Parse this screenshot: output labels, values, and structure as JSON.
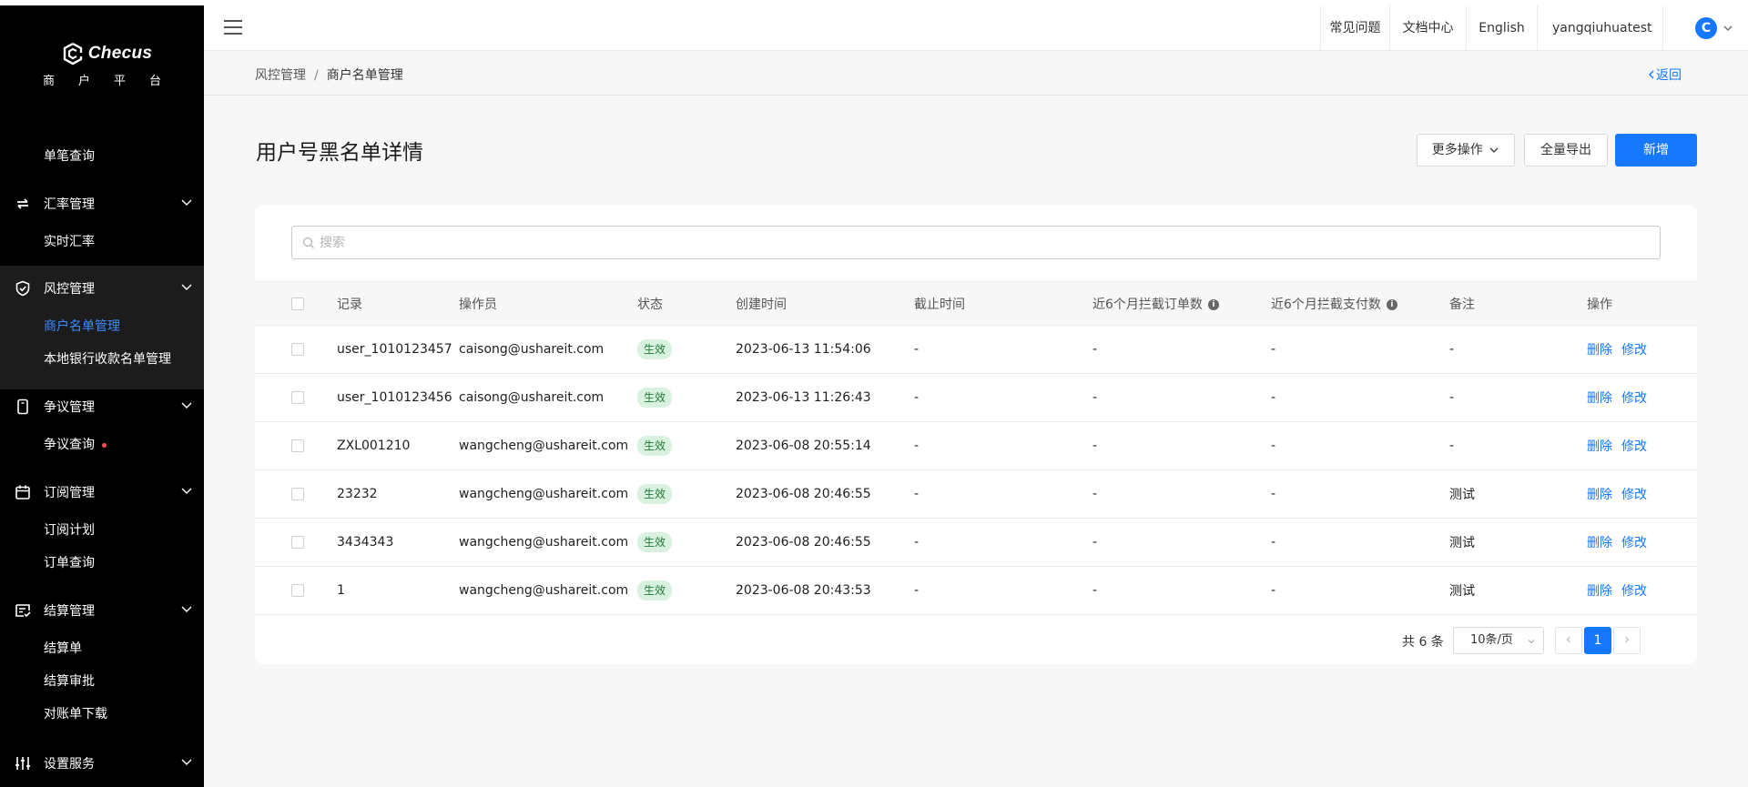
{
  "brand": {
    "name": "Checus",
    "subtitle": "商户平台"
  },
  "sidebar": {
    "single_query": "单笔查询",
    "groups": [
      {
        "label": "汇率管理",
        "icon": "exchange-icon",
        "items": [
          "实时汇率"
        ]
      },
      {
        "label": "风控管理",
        "icon": "shield-icon",
        "items": [
          "商户名单管理",
          "本地银行收款名单管理"
        ],
        "active_item": "商户名单管理"
      },
      {
        "label": "争议管理",
        "icon": "phone-icon",
        "items": [
          "争议查询"
        ]
      },
      {
        "label": "订阅管理",
        "icon": "calendar-icon",
        "items": [
          "订阅计划",
          "订单查询"
        ]
      },
      {
        "label": "结算管理",
        "icon": "invoice-icon",
        "items": [
          "结算单",
          "结算审批",
          "对账单下载"
        ]
      },
      {
        "label": "设置服务",
        "icon": "sliders-icon",
        "items": []
      }
    ]
  },
  "topbar": {
    "faq": "常见问题",
    "docs": "文档中心",
    "language": "English",
    "username": "yangqiuhuatest",
    "avatar_letter": "C"
  },
  "breadcrumb": {
    "parent": "风控管理",
    "separator": "/",
    "current": "商户名单管理",
    "back": "返回"
  },
  "page": {
    "title": "用户号黑名单详情",
    "more_actions": "更多操作",
    "export_all": "全量导出",
    "add_new": "新增"
  },
  "search": {
    "placeholder": "搜索"
  },
  "table": {
    "headers": [
      "记录",
      "操作员",
      "状态",
      "创建时间",
      "截止时间",
      "近6个月拦截订单数",
      "近6个月拦截支付数",
      "备注",
      "操作"
    ],
    "rows": [
      {
        "record": "user_1010123457",
        "operator": "caisong@ushareit.com",
        "status": "生效",
        "created": "2023-06-13 11:54:06",
        "deadline": "-",
        "orders": "-",
        "payments": "-",
        "remark": "-"
      },
      {
        "record": "user_1010123456",
        "operator": "caisong@ushareit.com",
        "status": "生效",
        "created": "2023-06-13 11:26:43",
        "deadline": "-",
        "orders": "-",
        "payments": "-",
        "remark": "-"
      },
      {
        "record": "ZXL001210",
        "operator": "wangcheng@ushareit.com",
        "status": "生效",
        "created": "2023-06-08 20:55:14",
        "deadline": "-",
        "orders": "-",
        "payments": "-",
        "remark": "-"
      },
      {
        "record": "23232",
        "operator": "wangcheng@ushareit.com",
        "status": "生效",
        "created": "2023-06-08 20:46:55",
        "deadline": "-",
        "orders": "-",
        "payments": "-",
        "remark": "测试"
      },
      {
        "record": "3434343",
        "operator": "wangcheng@ushareit.com",
        "status": "生效",
        "created": "2023-06-08 20:46:55",
        "deadline": "-",
        "orders": "-",
        "payments": "-",
        "remark": "测试"
      },
      {
        "record": "1",
        "operator": "wangcheng@ushareit.com",
        "status": "生效",
        "created": "2023-06-08 20:43:53",
        "deadline": "-",
        "orders": "-",
        "payments": "-",
        "remark": "测试"
      }
    ],
    "action_delete": "删除",
    "action_edit": "修改"
  },
  "pagination": {
    "total": "共 6 条",
    "page_size": "10条/页",
    "current_page": "1"
  },
  "colors": {
    "primary": "#1677ff",
    "sidebar_bg": "#000000",
    "status_tag_bg": "#d9f2df"
  }
}
